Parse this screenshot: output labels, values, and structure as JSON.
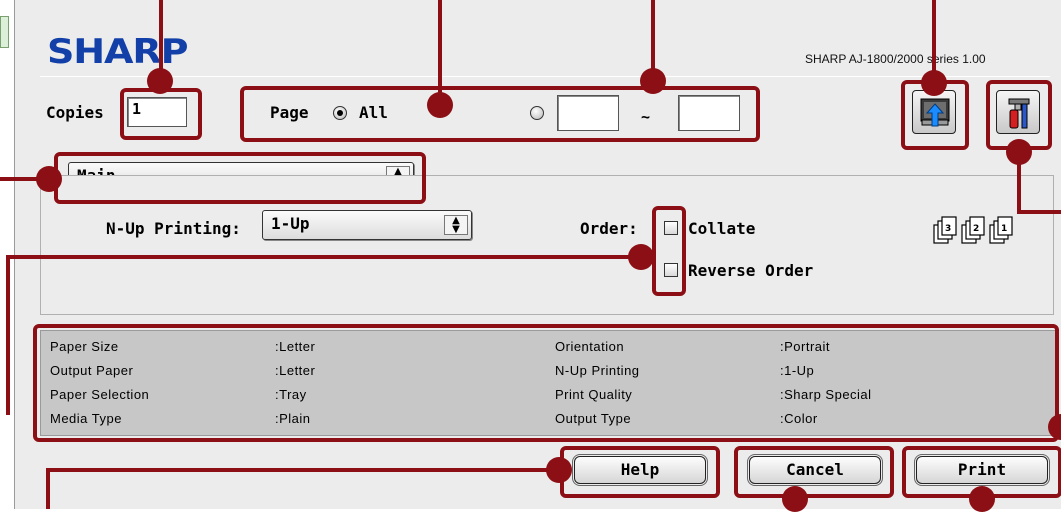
{
  "brand": {
    "logo": "SHARP",
    "version": "SHARP AJ-1800/2000 series 1.00"
  },
  "copies": {
    "label": "Copies",
    "value": "1"
  },
  "page": {
    "label": "Page",
    "all_label": "All",
    "from_value": "",
    "to_value": "",
    "range_separator": "~",
    "selected": "All"
  },
  "panel_menu": {
    "selected": "Main"
  },
  "nup": {
    "label": "N-Up Printing:",
    "value": "1-Up"
  },
  "order": {
    "label": "Order:",
    "collate_label": "Collate",
    "collate_checked": false,
    "reverse_label": "Reverse Order",
    "reverse_checked": false
  },
  "summary": {
    "rows": [
      {
        "k1": "Paper Size",
        "v1": ":Letter",
        "k2": "Orientation",
        "v2": ":Portrait"
      },
      {
        "k1": "Output Paper",
        "v1": ":Letter",
        "k2": "N-Up Printing",
        "v2": ":1-Up"
      },
      {
        "k1": "Paper Selection",
        "v1": ":Tray",
        "k2": "Print Quality",
        "v2": ":Sharp Special"
      },
      {
        "k1": "Media Type",
        "v1": ":Plain",
        "k2": "Output Type",
        "v2": ":Color"
      }
    ]
  },
  "buttons": {
    "help": "Help",
    "cancel": "Cancel",
    "print": "Print"
  },
  "icons": {
    "load_settings": "load-settings-icon",
    "utility": "utility-tools-icon",
    "collate_preview": "collate-pages-icon"
  },
  "colors": {
    "callout": "#8b0f14",
    "logo": "#1240a8",
    "summary_bg": "#c7c7c7"
  }
}
